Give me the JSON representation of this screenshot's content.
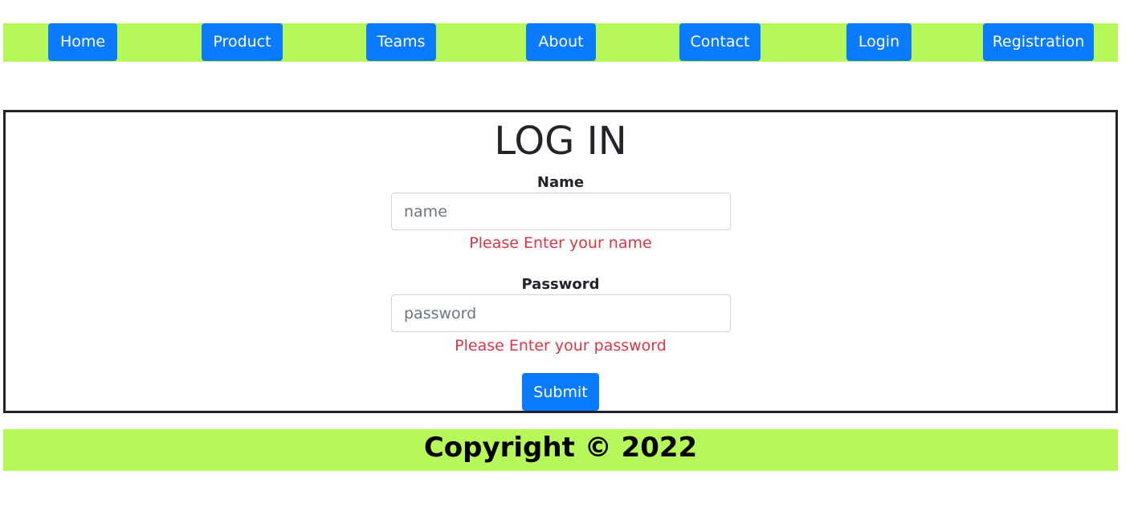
{
  "nav": {
    "items": [
      {
        "label": "Home"
      },
      {
        "label": "Product"
      },
      {
        "label": "Teams"
      },
      {
        "label": "About"
      },
      {
        "label": "Contact"
      },
      {
        "label": "Login"
      },
      {
        "label": "Registration"
      }
    ]
  },
  "login": {
    "title": "LOG IN",
    "name_label": "Name",
    "name_placeholder": "name",
    "name_value": "",
    "name_error": "Please Enter your name",
    "password_label": "Password",
    "password_placeholder": "password",
    "password_value": "",
    "password_error": "Please Enter your password",
    "submit_label": "Submit"
  },
  "footer": {
    "text": "Copyright © 2022"
  },
  "colors": {
    "accent": "#0a7bff",
    "bar": "#b6f75a",
    "error": "#dc3545"
  }
}
